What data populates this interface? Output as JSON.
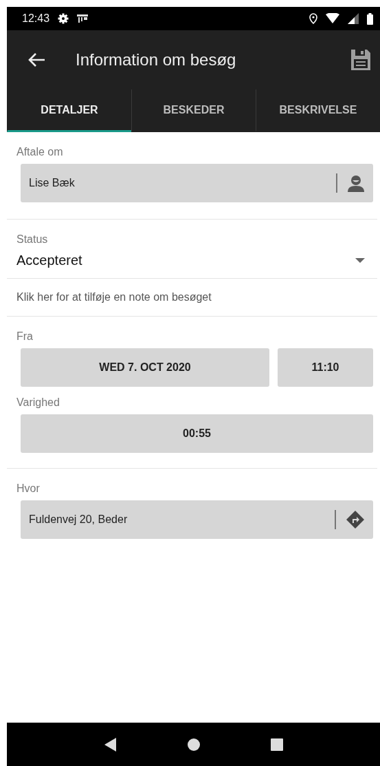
{
  "status_bar": {
    "time": "12:43"
  },
  "app_bar": {
    "title": "Information om besøg"
  },
  "tabs": [
    {
      "label": "DETALJER",
      "selected": true
    },
    {
      "label": "BESKEDER",
      "selected": false
    },
    {
      "label": "BESKRIVELSE",
      "selected": false
    }
  ],
  "appointment": {
    "label": "Aftale om",
    "value": "Lise Bæk"
  },
  "status": {
    "label": "Status",
    "value": "Accepteret"
  },
  "note_link": "Klik her for at tilføje en note om besøget",
  "from": {
    "label": "Fra",
    "date": "WED 7. OCT 2020",
    "time": "11:10"
  },
  "duration": {
    "label": "Varighed",
    "value": "00:55"
  },
  "location": {
    "label": "Hvor",
    "value": "Fuldenvej 20, Beder"
  }
}
